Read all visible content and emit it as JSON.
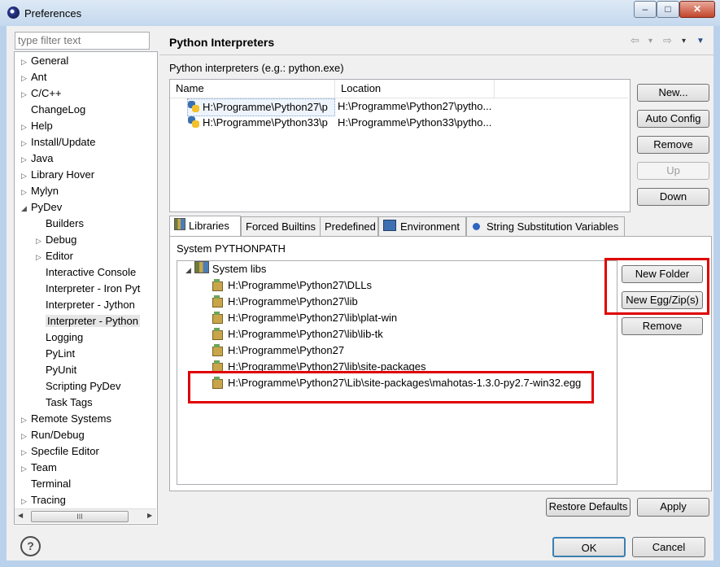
{
  "window": {
    "title": "Preferences",
    "minimize": "–",
    "maximize": "□",
    "close": "✕"
  },
  "filter": {
    "placeholder": "type filter text"
  },
  "tree": {
    "items": [
      {
        "label": "General",
        "expander": "▷"
      },
      {
        "label": "Ant",
        "expander": "▷"
      },
      {
        "label": "C/C++",
        "expander": "▷"
      },
      {
        "label": "ChangeLog",
        "expander": ""
      },
      {
        "label": "Help",
        "expander": "▷"
      },
      {
        "label": "Install/Update",
        "expander": "▷"
      },
      {
        "label": "Java",
        "expander": "▷"
      },
      {
        "label": "Library Hover",
        "expander": "▷"
      },
      {
        "label": "Mylyn",
        "expander": "▷"
      },
      {
        "label": "PyDev",
        "expander": "◢"
      },
      {
        "label": "Builders",
        "expander": ""
      },
      {
        "label": "Debug",
        "expander": "▷"
      },
      {
        "label": "Editor",
        "expander": "▷"
      },
      {
        "label": "Interactive Console",
        "expander": ""
      },
      {
        "label": "Interpreter - Iron Pyt",
        "expander": ""
      },
      {
        "label": "Interpreter - Jython",
        "expander": ""
      },
      {
        "label": "Interpreter - Python",
        "expander": ""
      },
      {
        "label": "Logging",
        "expander": ""
      },
      {
        "label": "PyLint",
        "expander": ""
      },
      {
        "label": "PyUnit",
        "expander": ""
      },
      {
        "label": "Scripting PyDev",
        "expander": ""
      },
      {
        "label": "Task Tags",
        "expander": ""
      },
      {
        "label": "Remote Systems",
        "expander": "▷"
      },
      {
        "label": "Run/Debug",
        "expander": "▷"
      },
      {
        "label": "Specfile Editor",
        "expander": "▷"
      },
      {
        "label": "Team",
        "expander": "▷"
      },
      {
        "label": "Terminal",
        "expander": ""
      },
      {
        "label": "Tracing",
        "expander": "▷"
      }
    ],
    "scroll_left": "◀",
    "scroll_right": "▶",
    "scroll_grip": "III"
  },
  "page": {
    "title": "Python Interpreters",
    "nav": {
      "back": "⇦",
      "back_menu": "▾",
      "forward": "⇨",
      "forward_menu": "▾",
      "view_menu": "▼"
    },
    "interpreters_label": "Python interpreters (e.g.: python.exe)",
    "table": {
      "columns": [
        "Name",
        "Location"
      ],
      "rows": [
        {
          "name": "H:\\Programme\\Python27\\p",
          "location": "H:\\Programme\\Python27\\pytho..."
        },
        {
          "name": "H:\\Programme\\Python33\\p",
          "location": "H:\\Programme\\Python33\\pytho..."
        }
      ]
    },
    "buttons": {
      "new": "New...",
      "auto_config": "Auto Config",
      "remove": "Remove",
      "up": "Up",
      "down": "Down"
    }
  },
  "tabs": [
    {
      "label": "Libraries",
      "icon": "library-icon"
    },
    {
      "label": "Forced Builtins",
      "icon": ""
    },
    {
      "label": "Predefined",
      "icon": ""
    },
    {
      "label": "Environment",
      "icon": "environment-icon"
    },
    {
      "label": "String Substitution Variables",
      "icon": "variable-icon"
    }
  ],
  "libraries": {
    "section_label": "System PYTHONPATH",
    "root": {
      "label": "System libs",
      "expander": "◢"
    },
    "paths": [
      "H:\\Programme\\Python27\\DLLs",
      "H:\\Programme\\Python27\\lib",
      "H:\\Programme\\Python27\\lib\\plat-win",
      "H:\\Programme\\Python27\\lib\\lib-tk",
      "H:\\Programme\\Python27",
      "H:\\Programme\\Python27\\lib\\site-packages",
      "H:\\Programme\\Python27\\Lib\\site-packages\\mahotas-1.3.0-py2.7-win32.egg"
    ],
    "buttons": {
      "new_folder": "New Folder",
      "new_egg": "New Egg/Zip(s)",
      "remove": "Remove"
    }
  },
  "footer": {
    "restore_defaults": "Restore Defaults",
    "apply": "Apply",
    "ok": "OK",
    "cancel": "Cancel",
    "help": "?"
  },
  "colors": {
    "highlight": "#e00000",
    "ok_border": "#3c7fb1"
  }
}
